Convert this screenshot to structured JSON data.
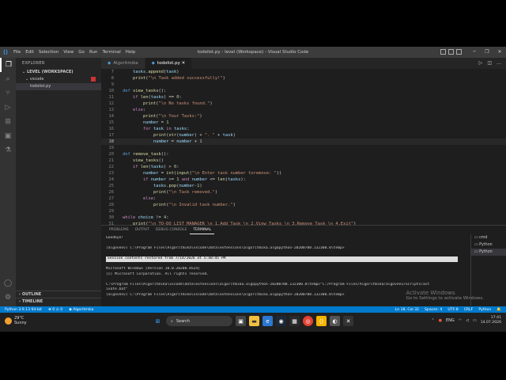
{
  "titlebar": {
    "menu": [
      "File",
      "Edit",
      "Selection",
      "View",
      "Go",
      "Run",
      "Terminal",
      "Help"
    ],
    "window_title": "todolist.py - level (Workspace) - Visual Studio Code"
  },
  "sidebar": {
    "header": "EXPLORER",
    "workspace": "LEVEL (WORKSPACE)",
    "folder": "vscode",
    "file": "todolist.py",
    "outline": "OUTLINE",
    "timeline": "TIMELINE"
  },
  "tabs": [
    {
      "label": "Algoritmika"
    },
    {
      "label": "todolist.py"
    }
  ],
  "panel": {
    "tabs": [
      "PROBLEMS",
      "OUTPUT",
      "DEBUG CONSOLE",
      "TERMINAL"
    ],
    "terminal_lines": [
      "Goodbye!",
      "",
      "(algovenv) C:\\Program Files\\Algoritmika\\vscode\\data\\extensions\\algoritmika.algopython-20200708.132300.0\\temp>",
      "",
      "Session contents restored from 7/14/2026 at 5:40:45 PM",
      "",
      "Microsoft Windows [Version 10.0.20200.8524]",
      "(c) Microsoft Corporation. All rights reserved.",
      "",
      "C:\\Program Files\\Algoritmika\\vscode\\data\\extensions\\algoritmika.algopython-20200708.132300.0\\temp>\"C:/Program Files/Algoritmika/algovenv/Scripts/act",
      "ivate.bat\"",
      "(algovenv) C:\\Program Files\\Algoritmika\\vscode\\data\\extensions\\algoritmika.algopython-20200708.132300.0\\temp>"
    ],
    "terminals": [
      "cmd",
      "Python",
      "Python"
    ],
    "watermark_title": "Activate Windows",
    "watermark_sub": "Go to Settings to activate Windows."
  },
  "statusbar": {
    "python": "Python 3.9.13 64-bit",
    "errors": "0",
    "warnings": "0",
    "extension": "Algoritmika",
    "position": "Ln 18, Col 32",
    "spaces": "Spaces: 4",
    "encoding": "UTF-8",
    "eol": "CRLF",
    "language": "Python"
  },
  "taskbar": {
    "temperature": "29°C",
    "weather": "Sunny",
    "search": "Search",
    "lang": "ENG",
    "time": "17:41",
    "date": "14.07.2026"
  }
}
